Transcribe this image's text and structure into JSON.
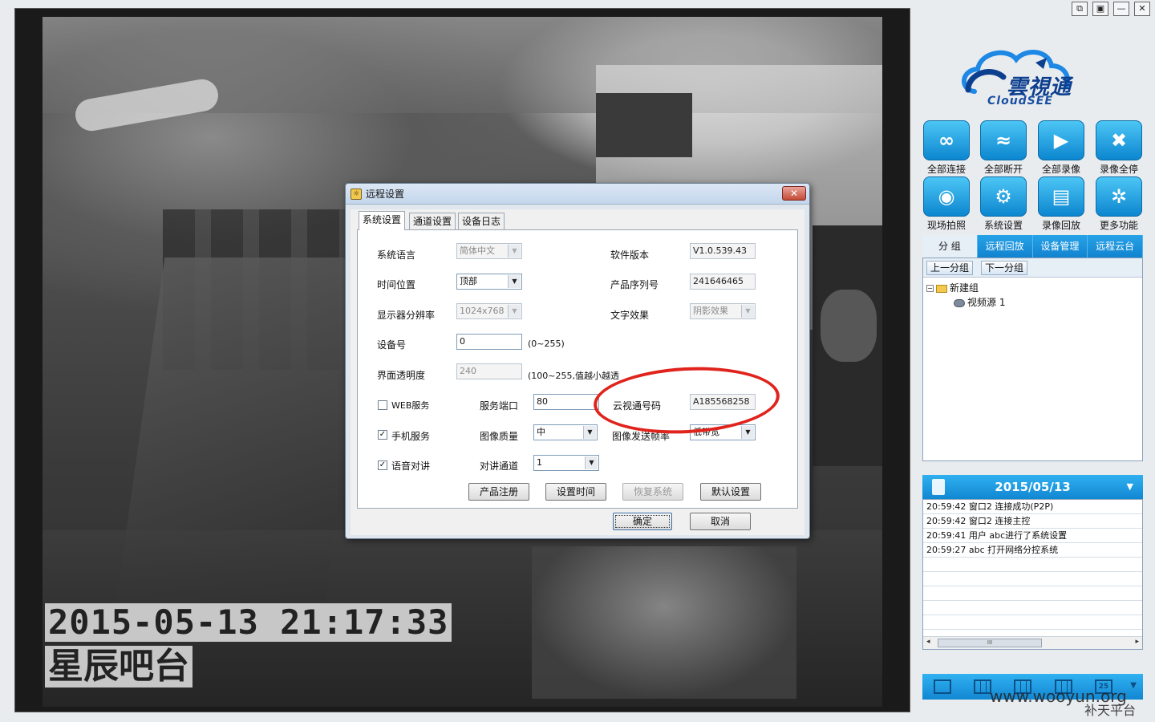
{
  "video": {
    "osd_time": "2015-05-13 21:17:33",
    "osd_label": "星辰吧台"
  },
  "dialog": {
    "title": "远程设置",
    "close": "✕",
    "tabs": [
      "系统设置",
      "通道设置",
      "设备日志"
    ],
    "fields": {
      "language_label": "系统语言",
      "language_value": "简体中文",
      "time_position_label": "时间位置",
      "time_position_value": "顶部",
      "resolution_label": "显示器分辨率",
      "resolution_value": "1024x768",
      "device_no_label": "设备号",
      "device_no_value": "0",
      "device_no_range": "(0~255)",
      "transparency_label": "界面透明度",
      "transparency_value": "240",
      "transparency_range": "(100~255,值越小越透",
      "web_service_label": "WEB服务",
      "web_service_checked": false,
      "service_port_label": "服务端口",
      "service_port_value": "80",
      "cloudsee_id_label": "云视通号码",
      "cloudsee_id_value": "A185568258",
      "mobile_service_label": "手机服务",
      "mobile_service_checked": true,
      "image_quality_label": "图像质量",
      "image_quality_value": "中",
      "frame_rate_label": "图像发送帧率",
      "frame_rate_value": "低带宽",
      "voice_talk_label": "语音对讲",
      "voice_talk_checked": true,
      "talk_channel_label": "对讲通道",
      "talk_channel_value": "1",
      "software_version_label": "软件版本",
      "software_version_value": "V1.0.539.43",
      "serial_label": "产品序列号",
      "serial_value": "241646465",
      "text_effect_label": "文字效果",
      "text_effect_value": "阴影效果"
    },
    "buttons": {
      "register": "产品注册",
      "set_time": "设置时间",
      "restore": "恢复系统",
      "default": "默认设置",
      "ok": "确定",
      "cancel": "取消"
    }
  },
  "window_controls": [
    "⧉",
    "▣",
    "—",
    "✕"
  ],
  "logo": {
    "brand": "雲視通",
    "sub": "CloudSEE"
  },
  "quick_actions": [
    {
      "label": "全部连接",
      "icon": "link-icon",
      "glyph": "∞"
    },
    {
      "label": "全部断开",
      "icon": "unlink-icon",
      "glyph": "≈"
    },
    {
      "label": "全部录像",
      "icon": "record-icon",
      "glyph": "▶"
    },
    {
      "label": "录像全停",
      "icon": "record-stop-icon",
      "glyph": "✖"
    },
    {
      "label": "现场拍照",
      "icon": "camera-icon",
      "glyph": "◉"
    },
    {
      "label": "系统设置",
      "icon": "gear-icon",
      "glyph": "⚙"
    },
    {
      "label": "录像回放",
      "icon": "clapboard-icon",
      "glyph": "▤"
    },
    {
      "label": "更多功能",
      "icon": "folder-gear-icon",
      "glyph": "✲"
    }
  ],
  "right_tabs": [
    "分 组",
    "远程回放",
    "设备管理",
    "远程云台"
  ],
  "group_buttons": {
    "prev": "上一分组",
    "next": "下一分组"
  },
  "tree": {
    "group": "新建组",
    "source": "视频源 1",
    "expander": "−"
  },
  "log": {
    "date": "2015/05/13",
    "entries": [
      "20:59:42 窗口2 连接成功(P2P)",
      "20:59:42 窗口2 连接主控",
      "20:59:41 用户 abc进行了系统设置",
      "20:59:27 abc 打开网络分控系统"
    ],
    "scroll_left": "◂",
    "scroll_right": "▸",
    "scroll_grip": "III"
  },
  "layout_bar": {
    "chevron": "▼",
    "layout_25": "25"
  },
  "watermark": {
    "site": "www.wooyun.org",
    "platform": "补天平台"
  }
}
